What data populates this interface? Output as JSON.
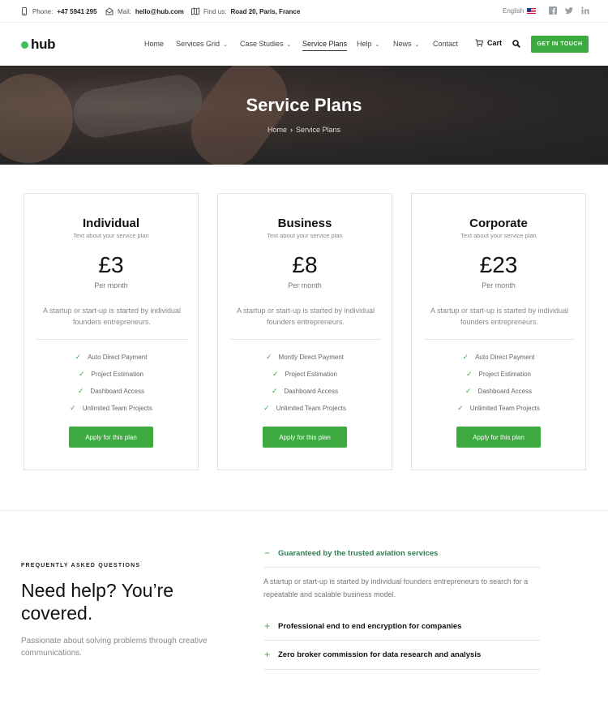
{
  "topbar": {
    "phone_label": "Phone:",
    "phone": "+47 5941 295",
    "mail_label": "Mail:",
    "mail": "hello@hub.com",
    "find_label": "Find us:",
    "address": "Road 20, Paris, France",
    "language": "English"
  },
  "nav": {
    "logo": "hub",
    "items": [
      {
        "label": "Home",
        "dropdown": false
      },
      {
        "label": "Services Grid",
        "dropdown": true
      },
      {
        "label": "Case Studies",
        "dropdown": true
      },
      {
        "label": "Service Plans",
        "dropdown": false,
        "active": true
      },
      {
        "label": "Help",
        "dropdown": true
      },
      {
        "label": "News",
        "dropdown": true
      },
      {
        "label": "Contact",
        "dropdown": false
      }
    ],
    "cart": "Cart",
    "cta": "GET IN TOUCH"
  },
  "hero": {
    "title": "Service Plans",
    "breadcrumb": [
      "Home",
      "Service Plans"
    ]
  },
  "plans": [
    {
      "name": "Individual",
      "subtitle": "Text about your service plan",
      "price": "£3",
      "period": "Per month",
      "description": "A startup or start-up is started by individual founders entrepreneurs.",
      "features": [
        "Auto Direct Payment",
        "Project Estimation",
        "Dashboard Access",
        "Unlimited Team Projects"
      ],
      "button": "Apply for this plan"
    },
    {
      "name": "Business",
      "subtitle": "Text about your service plan",
      "price": "£8",
      "period": "Per month",
      "description": "A startup or start-up is started by individual founders entrepreneurs.",
      "features": [
        "Montly Direct Payment",
        "Project Estimation",
        "Dashboard Access",
        "Unlimited Team Projects"
      ],
      "button": "Apply for this plan"
    },
    {
      "name": "Corporate",
      "subtitle": "Text about your service plan",
      "price": "£23",
      "period": "Per month",
      "description": "A startup or start-up is started by individual founders entrepreneurs.",
      "features": [
        "Auto Direct Payment",
        "Project Estimation",
        "Dashboard Access",
        "Unlimited Team Projects"
      ],
      "button": "Apply for this plan"
    }
  ],
  "faq": {
    "kicker": "FREQUENTLY ASKED QUESTIONS",
    "heading": "Need help? You’re covered.",
    "text": "Passionate about solving problems through creative communications.",
    "items": [
      {
        "question": "Guaranteed by the trusted aviation services",
        "open": true,
        "answer": "A startup or start-up is started by individual founders entrepreneurs to search for a repeatable and scalable business model."
      },
      {
        "question": "Professional end to end encryption for companies",
        "open": false
      },
      {
        "question": "Zero broker commission for data research and analysis",
        "open": false
      }
    ]
  },
  "colors": {
    "accent": "#3caa3f",
    "faq_open": "#2f7d52"
  },
  "icons": [
    "phone-icon",
    "mail-icon",
    "map-icon",
    "facebook-icon",
    "twitter-icon",
    "linkedin-icon",
    "cart-icon",
    "search-icon",
    "check-icon",
    "minus-icon",
    "plus-icon"
  ]
}
